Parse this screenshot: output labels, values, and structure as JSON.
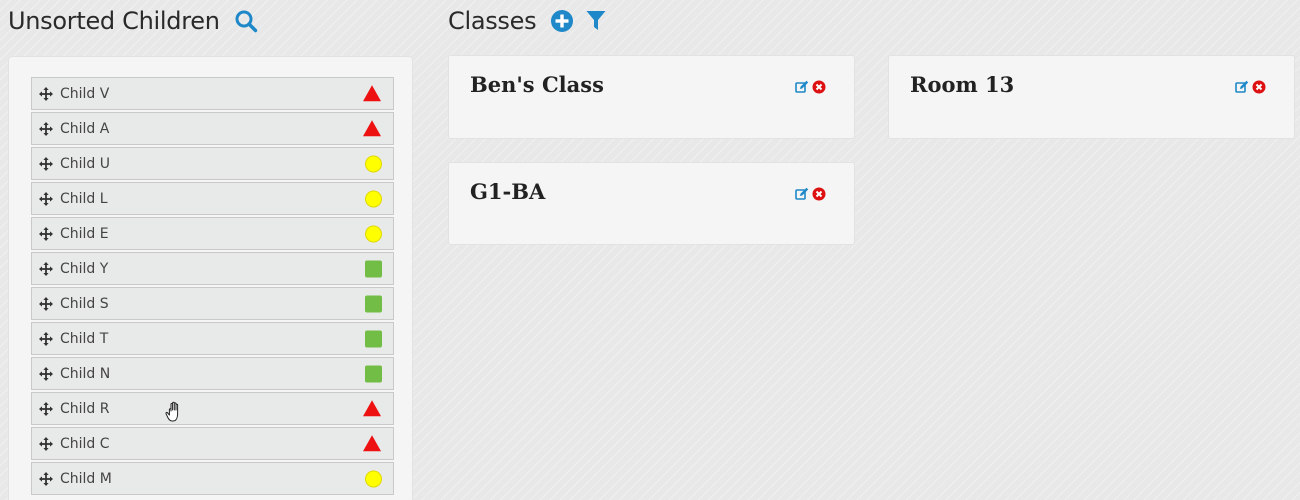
{
  "unsorted": {
    "title": "Unsorted Children",
    "search_icon": "search-icon",
    "children": [
      {
        "name": "Child V",
        "status": "triangle",
        "color": "#ee1111"
      },
      {
        "name": "Child A",
        "status": "triangle",
        "color": "#ee1111"
      },
      {
        "name": "Child U",
        "status": "circle",
        "color": "#ffff00"
      },
      {
        "name": "Child L",
        "status": "circle",
        "color": "#ffff00"
      },
      {
        "name": "Child E",
        "status": "circle",
        "color": "#ffff00"
      },
      {
        "name": "Child Y",
        "status": "square",
        "color": "#72bd45"
      },
      {
        "name": "Child S",
        "status": "square",
        "color": "#72bd45"
      },
      {
        "name": "Child T",
        "status": "square",
        "color": "#72bd45"
      },
      {
        "name": "Child N",
        "status": "square",
        "color": "#72bd45"
      },
      {
        "name": "Child R",
        "status": "triangle",
        "color": "#ee1111"
      },
      {
        "name": "Child C",
        "status": "triangle",
        "color": "#ee1111"
      },
      {
        "name": "Child M",
        "status": "circle",
        "color": "#ffff00"
      }
    ]
  },
  "classes": {
    "title": "Classes",
    "add_icon": "plus-circle-icon",
    "filter_icon": "filter-icon",
    "items": [
      {
        "name": "Ben's Class"
      },
      {
        "name": "Room 13"
      },
      {
        "name": "G1-BA"
      }
    ]
  },
  "colors": {
    "accent": "#1e88c8",
    "delete": "#dd1111",
    "red_status": "#ee1111",
    "yellow_status": "#ffff00",
    "green_status": "#72bd45"
  }
}
